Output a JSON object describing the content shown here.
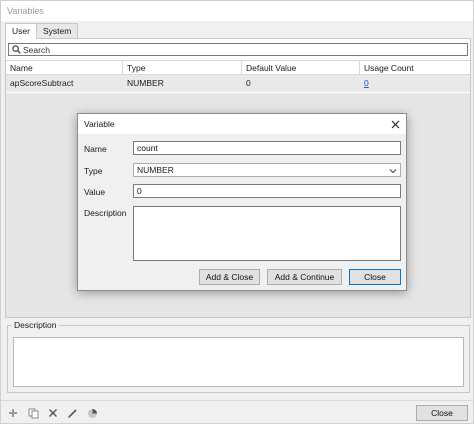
{
  "window": {
    "title": "Variables"
  },
  "tabs": [
    {
      "label": "User"
    },
    {
      "label": "System"
    }
  ],
  "search": {
    "placeholder": "Search"
  },
  "table": {
    "columns": [
      "Name",
      "Type",
      "Default Value",
      "Usage Count"
    ],
    "rows": [
      {
        "name": "apScoreSubtract",
        "type": "NUMBER",
        "default_value": "0",
        "usage_count": "0"
      }
    ]
  },
  "description_panel": {
    "label": "Description",
    "value": ""
  },
  "toolbar": {
    "icons": [
      "add-icon",
      "copy-icon",
      "delete-icon",
      "edit-icon",
      "usage-chart-icon"
    ],
    "close_label": "Close"
  },
  "dialog": {
    "title": "Variable",
    "name_label": "Name",
    "name_value": "count",
    "type_label": "Type",
    "type_value": "NUMBER",
    "value_label": "Value",
    "value_value": "0",
    "description_label": "Description",
    "description_value": "",
    "buttons": {
      "add_close": "Add & Close",
      "add_continue": "Add & Continue",
      "close": "Close"
    }
  },
  "colors": {
    "link": "#1f4fd8",
    "focus_border": "#0078d7",
    "row_selected": "#e9e9e9"
  }
}
